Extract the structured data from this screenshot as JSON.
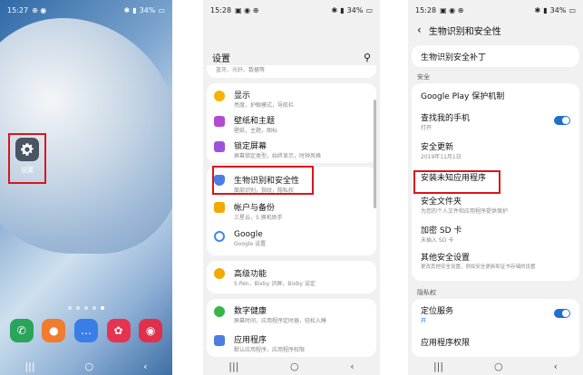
{
  "phone1": {
    "time": "15:27",
    "battery": "34%",
    "settings_label": "设置",
    "nav": [
      "|||",
      "○",
      "‹"
    ]
  },
  "phone2": {
    "time": "15:28",
    "battery": "34%",
    "title": "设置",
    "search_sub": "蓝牙、光纤、数据等",
    "items": [
      {
        "title": "显示",
        "sub": "亮度，护眼模式，导航栏",
        "icon": "sun-icon",
        "color": "#f2b400"
      },
      {
        "title": "壁纸和主题",
        "sub": "壁纸，主题，图标",
        "icon": "brush-icon",
        "color": "#b34bd1"
      },
      {
        "title": "锁定屏幕",
        "sub": "屏幕锁定类型，始终显示，时钟风格",
        "icon": "lock-screen-icon",
        "color": "#9b54d9"
      },
      {
        "title": "生物识别和安全性",
        "sub": "面部识别，指纹，隐私权",
        "icon": "shield-icon",
        "color": "#4c7de4"
      },
      {
        "title": "帐户与备份",
        "sub": "三星云，S 换机助手",
        "icon": "key-icon",
        "color": "#f2a900"
      },
      {
        "title": "Google",
        "sub": "Google 设置",
        "icon": "google-icon",
        "color": "#4285f4"
      },
      {
        "title": "高级功能",
        "sub": "S Pen，Bixby 识屏，Bixby 设定",
        "icon": "gear-plus-icon",
        "color": "#f2a900"
      },
      {
        "title": "数字健康",
        "sub": "屏幕时间，应用程序定时器，轻松入睡",
        "icon": "wellbeing-icon",
        "color": "#3bb54a"
      },
      {
        "title": "应用程序",
        "sub": "默认应用程序，应用程序权限",
        "icon": "apps-icon",
        "color": "#4c7de4"
      }
    ],
    "nav": [
      "|||",
      "○",
      "‹"
    ]
  },
  "phone3": {
    "time": "15:28",
    "battery": "34%",
    "title": "生物识别和安全性",
    "first_item": "生物识别安全补丁",
    "section_security": "安全",
    "items": [
      {
        "title": "Google Play 保护机制",
        "sub": ""
      },
      {
        "title": "查找我的手机",
        "sub": "打开",
        "toggle": true
      },
      {
        "title": "安全更新",
        "sub": "2019年11月1日"
      },
      {
        "title": "安装未知应用程序",
        "sub": ""
      },
      {
        "title": "安全文件夹",
        "sub": "为您的个人文件和应用程序提供保护"
      },
      {
        "title": "加密 SD 卡",
        "sub": "未插入 SD 卡"
      },
      {
        "title": "其他安全设置",
        "sub": "更改其他安全设置，例如安全更新和证书存储的设置"
      }
    ],
    "section_privacy": "隐私权",
    "privacy_items": [
      {
        "title": "定位服务",
        "sub": "开",
        "toggle": true
      },
      {
        "title": "应用程序权限",
        "sub": ""
      }
    ],
    "nav": [
      "|||",
      "○",
      "‹"
    ]
  }
}
